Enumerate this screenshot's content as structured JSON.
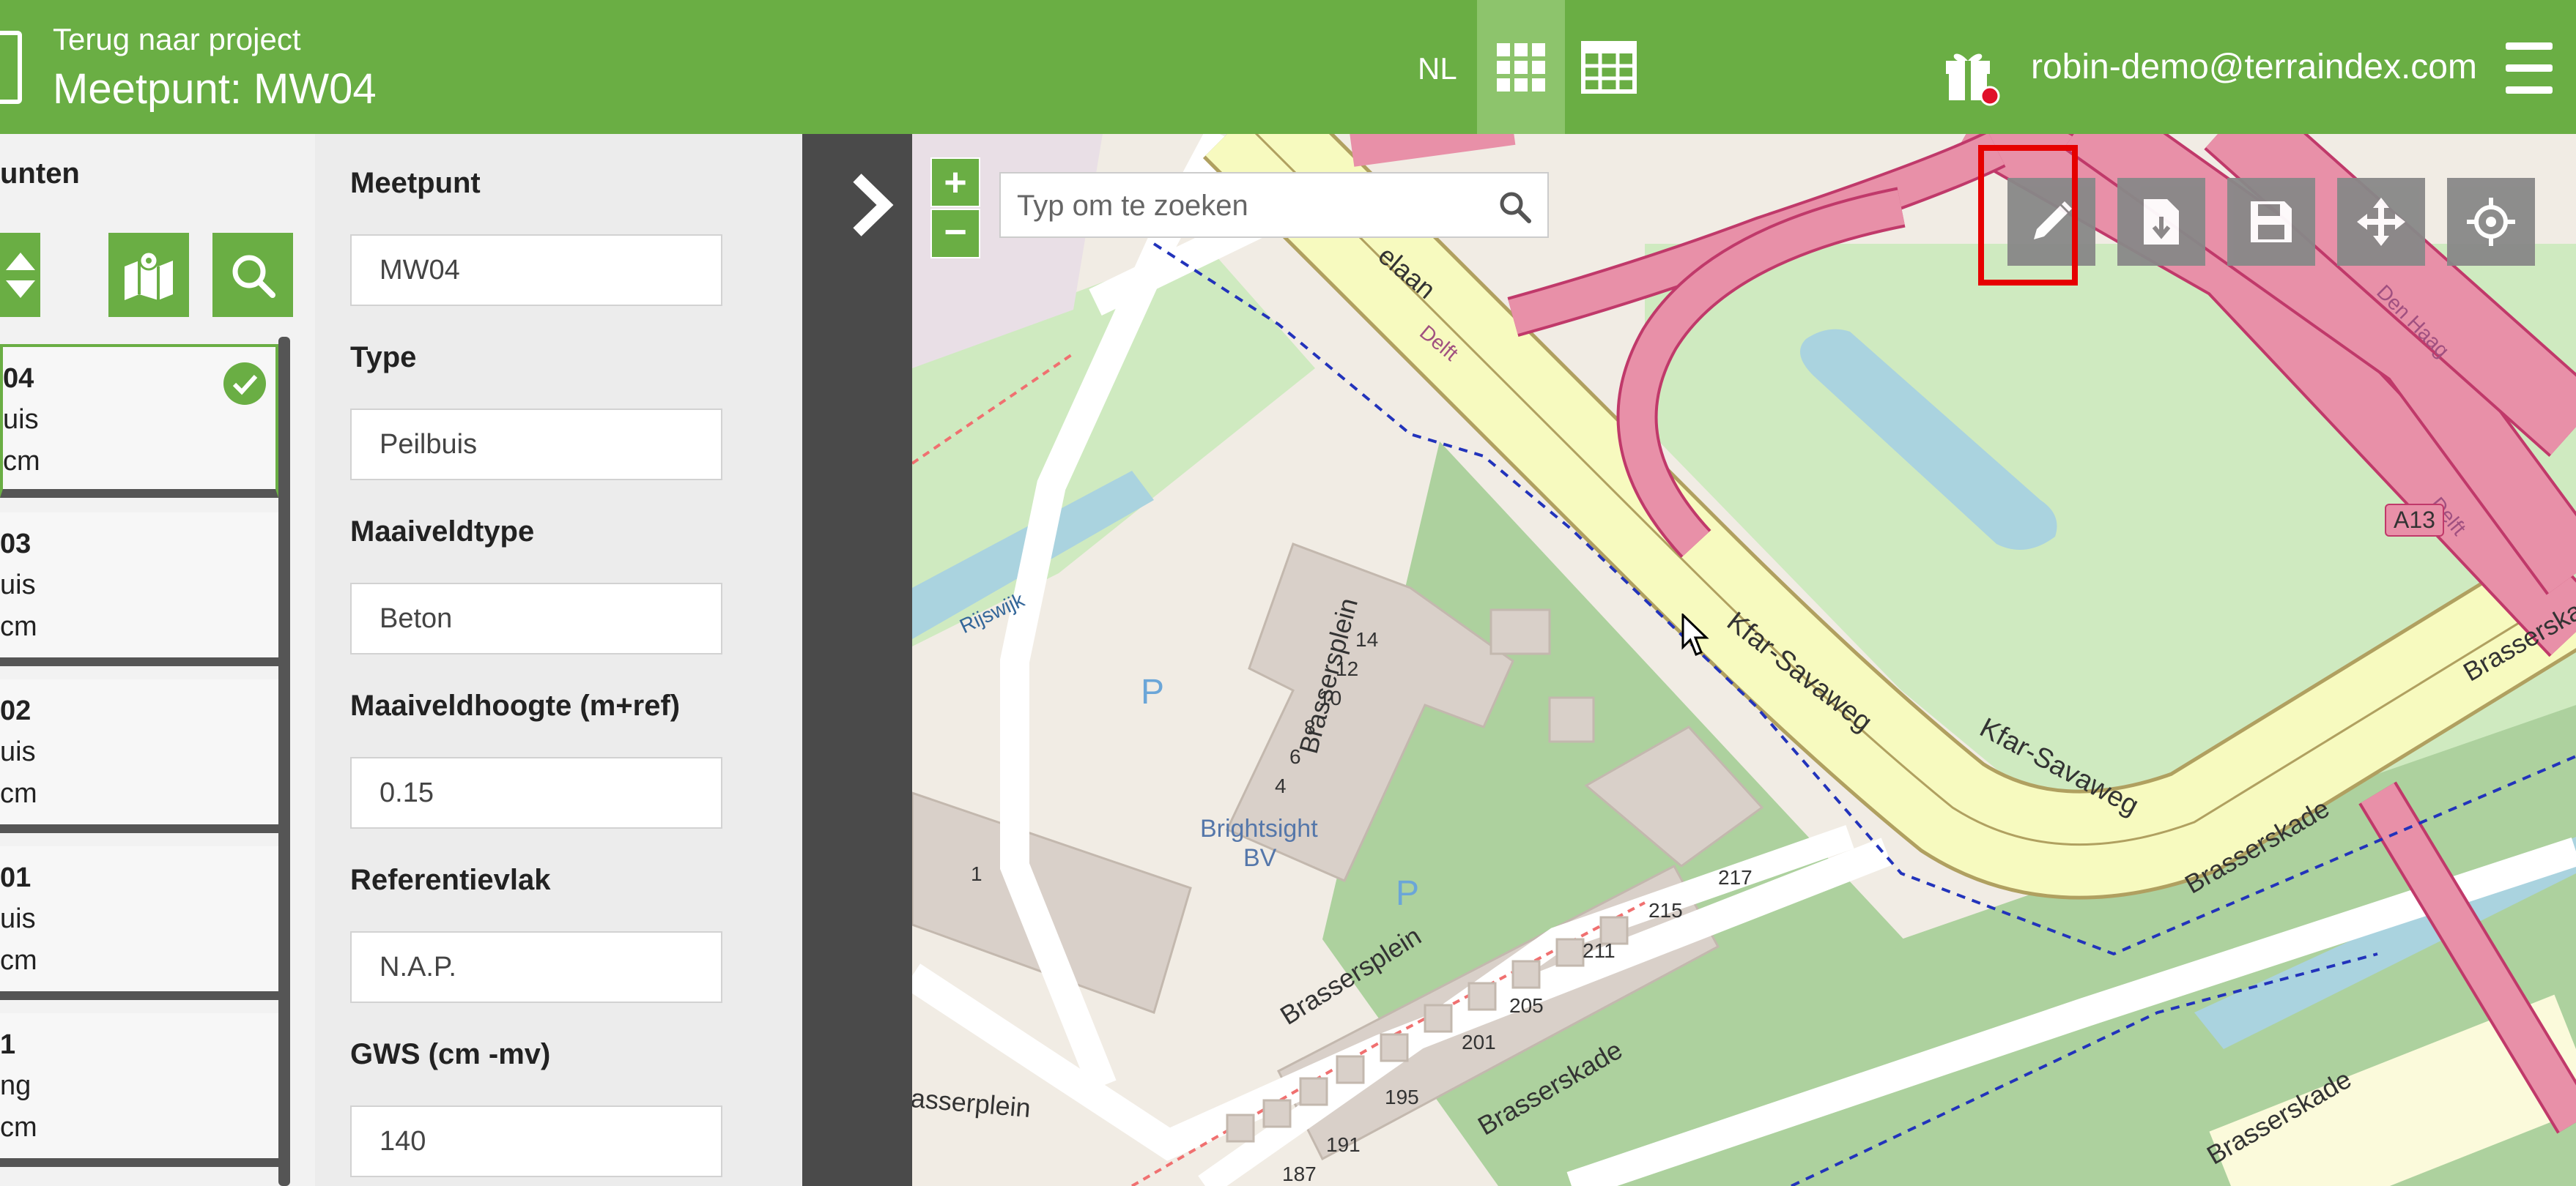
{
  "header": {
    "back_link": "Terug naar project",
    "title": "Meetpunt: MW04",
    "language": "NL",
    "user_email": "robin-demo@terraindex.com",
    "colors": {
      "primary": "#6aae44",
      "active_view": "#8dc46c"
    }
  },
  "icons": [
    "logo-icon",
    "grid-view-icon",
    "table-view-icon",
    "gift-icon",
    "menu-icon",
    "sort-icon",
    "map-icon",
    "search-icon",
    "check-icon",
    "chevron-right-icon",
    "edit-icon",
    "export-icon",
    "save-icon",
    "move-icon",
    "locate-icon"
  ],
  "list_panel": {
    "title": "unten",
    "items": [
      {
        "id": "04",
        "type": "uis",
        "unit": "cm",
        "checked": true
      },
      {
        "id": "03",
        "type": "uis",
        "unit": "cm"
      },
      {
        "id": "02",
        "type": "uis",
        "unit": "cm"
      },
      {
        "id": "01",
        "type": "uis",
        "unit": "cm"
      },
      {
        "id": "1",
        "type": "ng",
        "unit": "cm"
      }
    ]
  },
  "form": {
    "fields": [
      {
        "label": "Meetpunt",
        "value": "MW04"
      },
      {
        "label": "Type",
        "value": "Peilbuis"
      },
      {
        "label": "Maaiveldtype",
        "value": "Beton"
      },
      {
        "label": "Maaiveldhoogte (m+ref)",
        "value": "0.15"
      },
      {
        "label": "Referentievlak",
        "value": "N.A.P."
      },
      {
        "label": "GWS (cm -mv)",
        "value": "140"
      }
    ]
  },
  "map": {
    "zoom_in": "+",
    "zoom_out": "−",
    "search_placeholder": "Typ om te zoeken",
    "labels": {
      "street1": "Kfar-Savaweg",
      "street2": "Kfar-Savaweg",
      "street3": "Brasserskade",
      "street4": "Brasserskade",
      "street5": "Brasserskade",
      "street6": "Brassersplein",
      "street7": "Brassersplein",
      "street8": "asserplein",
      "street9": "Brasserskade",
      "street10": "elaan",
      "poi": "Brightsight",
      "poi2": "BV",
      "city1": "Delft",
      "city2": "Den Haag",
      "city3": "Delft",
      "city4": "Rijswijk",
      "road_badge": "A13",
      "parking": "P",
      "parking2": "P",
      "house_numbers": [
        "14",
        "12",
        "10",
        "8",
        "6",
        "4",
        "1",
        "217",
        "215",
        "211",
        "205",
        "201",
        "195",
        "191",
        "187"
      ]
    }
  }
}
